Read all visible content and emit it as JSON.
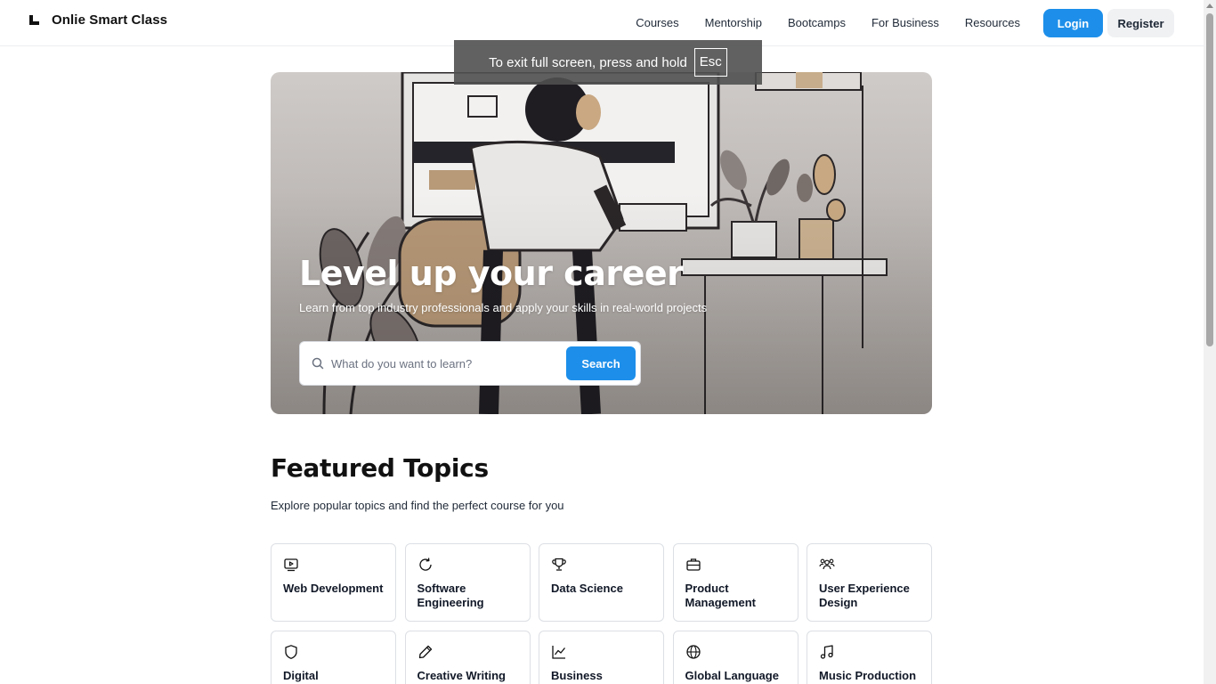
{
  "header": {
    "brand": "Onlie Smart Class",
    "nav": [
      "Courses",
      "Mentorship",
      "Bootcamps",
      "For Business",
      "Resources"
    ],
    "login": "Login",
    "register": "Register"
  },
  "toast": {
    "text": "To exit full screen, press and hold",
    "key": "Esc"
  },
  "hero": {
    "title": "Level up your career",
    "subtitle": "Learn from top industry professionals and apply your skills in real-world projects",
    "search_placeholder": "What do you want to learn?",
    "search_button": "Search"
  },
  "featured": {
    "title": "Featured Topics",
    "subtitle": "Explore popular topics and find the perfect course for you",
    "topics": [
      {
        "label": "Web Development",
        "icon": "video-icon"
      },
      {
        "label": "Software Engineering",
        "icon": "refresh-icon"
      },
      {
        "label": "Data Science",
        "icon": "trophy-icon"
      },
      {
        "label": "Product Management",
        "icon": "briefcase-icon"
      },
      {
        "label": "User Experience Design",
        "icon": "users-icon"
      },
      {
        "label": "Digital",
        "icon": "shield-icon"
      },
      {
        "label": "Creative Writing",
        "icon": "pencil-icon"
      },
      {
        "label": "Business",
        "icon": "chart-line-icon"
      },
      {
        "label": "Global Language",
        "icon": "globe-icon"
      },
      {
        "label": "Music Production",
        "icon": "music-icon"
      }
    ]
  },
  "colors": {
    "accent": "#1d8fea",
    "text": "#111827",
    "border": "#dcdfe4"
  }
}
